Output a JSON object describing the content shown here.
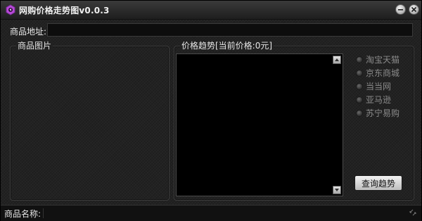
{
  "window": {
    "title": "网购价格走势图v0.0.3"
  },
  "url_row": {
    "label": "商品地址:",
    "value": ""
  },
  "image_group": {
    "legend": "商品图片"
  },
  "trend_group": {
    "legend": "价格趋势[当前价格:0元]"
  },
  "stores": [
    {
      "label": "淘宝天猫"
    },
    {
      "label": "京东商城"
    },
    {
      "label": "当当网"
    },
    {
      "label": "亚马逊"
    },
    {
      "label": "苏宁易购"
    }
  ],
  "query_button": {
    "label": "查询趋势"
  },
  "statusbar": {
    "label": "商品名称:",
    "value": ""
  },
  "colors": {
    "background": "#222222",
    "titlebar": "#2a2a2a",
    "panel": "#000000",
    "accent_icon": "#b84ad8"
  }
}
